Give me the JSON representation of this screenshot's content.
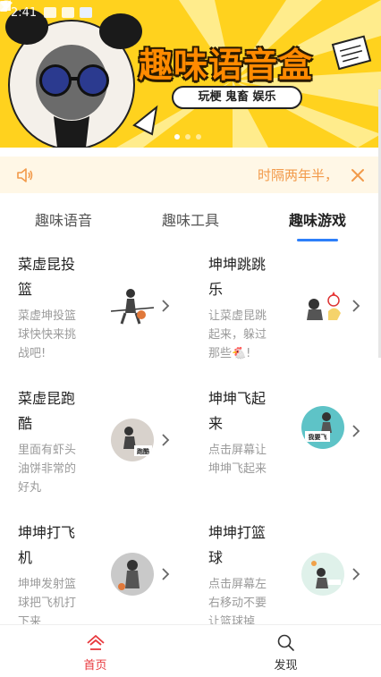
{
  "status_bar": {
    "time": "2:41"
  },
  "banner": {
    "title": "趣味语音盒",
    "subtitle": "玩梗 鬼畜 娱乐",
    "pages": 3,
    "active_page": 1
  },
  "notice": {
    "text": "时隔两年半，"
  },
  "tabs": [
    {
      "label": "趣味语音",
      "active": false
    },
    {
      "label": "趣味工具",
      "active": false
    },
    {
      "label": "趣味游戏",
      "active": true
    }
  ],
  "games": [
    {
      "title": "菜虚昆投篮",
      "desc": "菜虚坤投篮球快快来挑战吧!"
    },
    {
      "title": "坤坤跳跳乐",
      "desc": "让菜虚昆跳起来，躲过那些🐔!"
    },
    {
      "title": "菜虚昆跑酷",
      "desc": "里面有虾头油饼非常的好丸"
    },
    {
      "title": "坤坤飞起来",
      "desc": "点击屏幕让坤坤飞起来"
    },
    {
      "title": "坤坤打飞机",
      "desc": "坤坤发射篮球把飞机打下来"
    },
    {
      "title": "坤坤打篮球",
      "desc": "点击屏幕左右移动不要让篮球掉"
    }
  ],
  "thumb_texts": {
    "pao": "跑酷",
    "fei": "我要飞"
  },
  "bottom_nav": [
    {
      "label": "首页",
      "icon": "home-icon",
      "active": true
    },
    {
      "label": "发现",
      "icon": "search-icon",
      "active": false
    }
  ],
  "colors": {
    "accent_blue": "#2d7ff9",
    "accent_red": "#e8383d",
    "notice_text": "#f29a4a",
    "banner_yellow": "#ffd21e"
  }
}
